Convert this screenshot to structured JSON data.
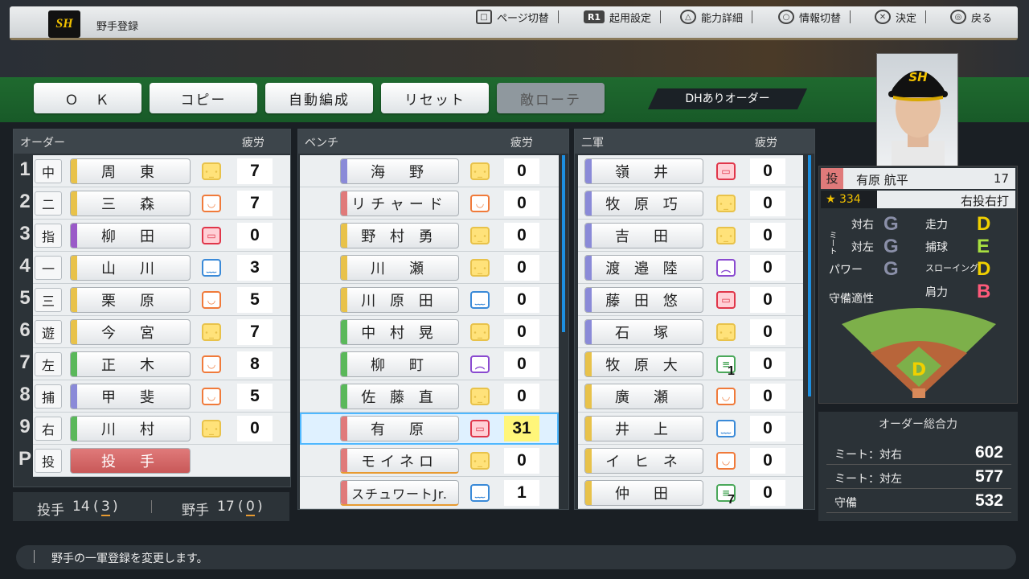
{
  "screen": {
    "title": "野手登録",
    "logo_text": "SH"
  },
  "hints": [
    {
      "btn": "□",
      "label": "ページ切替"
    },
    {
      "btn": "R1",
      "label": "起用設定"
    },
    {
      "btn": "△",
      "label": "能力詳細"
    },
    {
      "btn": "○",
      "label": "情報切替"
    },
    {
      "btn": "✕",
      "label": "決定"
    },
    {
      "btn": "◎",
      "label": "戻る"
    }
  ],
  "toolbar": {
    "ok": "Ｏ　Ｋ",
    "copy": "コピー",
    "auto": "自動編成",
    "reset": "リセット",
    "enemy": "敵ローテ",
    "dh": "DHありオーダー"
  },
  "order": {
    "header": "オーダー",
    "fatigue_header": "疲労",
    "rows": [
      {
        "num": "1",
        "pos": "中",
        "name": "周　東",
        "face": "neutral",
        "fatigue": "7"
      },
      {
        "num": "2",
        "pos": "二",
        "name": "三　森",
        "face": "good",
        "fatigue": "7"
      },
      {
        "num": "3",
        "pos": "指",
        "name": "柳　田",
        "face": "best",
        "fatigue": "0"
      },
      {
        "num": "4",
        "pos": "一",
        "name": "山　川",
        "face": "bad",
        "fatigue": "3"
      },
      {
        "num": "5",
        "pos": "三",
        "name": "栗　原",
        "face": "good",
        "fatigue": "5"
      },
      {
        "num": "6",
        "pos": "遊",
        "name": "今　宮",
        "face": "neutral",
        "fatigue": "7"
      },
      {
        "num": "7",
        "pos": "左",
        "name": "正　木",
        "face": "good",
        "fatigue": "8"
      },
      {
        "num": "8",
        "pos": "捕",
        "name": "甲　斐",
        "face": "good",
        "fatigue": "5"
      },
      {
        "num": "9",
        "pos": "右",
        "name": "川　村",
        "face": "neutral",
        "fatigue": "0"
      },
      {
        "num": "P",
        "pos": "投",
        "name": "投　手",
        "face": "",
        "fatigue": ""
      }
    ]
  },
  "bench": {
    "header": "ベンチ",
    "fatigue_header": "疲労",
    "rows": [
      {
        "name": "海　野",
        "face": "neutral",
        "fatigue": "0"
      },
      {
        "name": "リチャード",
        "face": "good",
        "fatigue": "0"
      },
      {
        "name": "野 村 勇",
        "face": "neutral",
        "fatigue": "0"
      },
      {
        "name": "川　瀬",
        "face": "neutral",
        "fatigue": "0"
      },
      {
        "name": "川 原 田",
        "face": "bad",
        "fatigue": "0"
      },
      {
        "name": "中 村 晃",
        "face": "neutral",
        "fatigue": "0"
      },
      {
        "name": "柳　町",
        "face": "worst",
        "fatigue": "0"
      },
      {
        "name": "佐 藤 直",
        "face": "neutral",
        "fatigue": "0"
      },
      {
        "name": "有　原",
        "face": "best",
        "fatigue": "31"
      },
      {
        "name": "モイネロ",
        "face": "neutral",
        "fatigue": "0"
      },
      {
        "name": "スチュワートJr.",
        "face": "bad",
        "fatigue": "1"
      }
    ]
  },
  "farm": {
    "header": "二軍",
    "fatigue_header": "疲労",
    "rows": [
      {
        "name": "嶺　井",
        "face": "best",
        "fatigue": "0",
        "badge": ""
      },
      {
        "name": "牧 原 巧",
        "face": "neutral",
        "fatigue": "0",
        "badge": ""
      },
      {
        "name": "吉　田",
        "face": "neutral",
        "fatigue": "0",
        "badge": ""
      },
      {
        "name": "渡 邉 陸",
        "face": "worst",
        "fatigue": "0",
        "badge": ""
      },
      {
        "name": "藤 田 悠",
        "face": "best",
        "fatigue": "0",
        "badge": ""
      },
      {
        "name": "石　塚",
        "face": "neutral",
        "fatigue": "0",
        "badge": ""
      },
      {
        "name": "牧 原 大",
        "face": "green",
        "fatigue": "0",
        "badge": "1"
      },
      {
        "name": "廣　瀬",
        "face": "good",
        "fatigue": "0",
        "badge": ""
      },
      {
        "name": "井　上",
        "face": "bad",
        "fatigue": "0",
        "badge": ""
      },
      {
        "name": "イ ヒ ネ",
        "face": "good",
        "fatigue": "0",
        "badge": ""
      },
      {
        "name": "仲　田",
        "face": "green",
        "fatigue": "0",
        "badge": "7"
      }
    ]
  },
  "counts": {
    "pitcher_label": "投手",
    "pitcher_count": "14",
    "pitcher_sub": "3",
    "fielder_label": "野手",
    "fielder_count": "17",
    "fielder_sub": "0"
  },
  "player": {
    "role": "投",
    "name": "有原 航平",
    "number": "17",
    "rating": "★ 334",
    "throws": "右投右打",
    "stats": [
      {
        "label": "対右",
        "grade": "G",
        "color": "#8a8fa8"
      },
      {
        "label": "対左",
        "grade": "G",
        "color": "#8a8fa8"
      },
      {
        "label": "パワー",
        "grade": "G",
        "color": "#8a8fa8"
      },
      {
        "label": "走力",
        "grade": "D",
        "color": "#f0d000"
      },
      {
        "label": "捕球",
        "grade": "E",
        "color": "#a8e040"
      },
      {
        "label": "スローイング",
        "grade": "D",
        "color": "#f0d000"
      },
      {
        "label": "肩力",
        "grade": "B",
        "color": "#ff5a7a"
      }
    ],
    "meet_label": "ミート",
    "defense_label": "守備適性",
    "field_grade": "D"
  },
  "overall": {
    "header": "オーダー総合力",
    "rows": [
      {
        "label": "ミート：対右",
        "value": "602"
      },
      {
        "label": "ミート：対左",
        "value": "577"
      },
      {
        "label": "守備",
        "value": "532"
      }
    ]
  },
  "help": {
    "text": "野手の一軍登録を変更します。"
  },
  "colors": {
    "neutral": "#e8c24a",
    "good": "#f07a3a",
    "best": "#e0364a",
    "bad": "#3a8ad8",
    "worst": "#8a4ad0",
    "green": "#4aa85a"
  }
}
